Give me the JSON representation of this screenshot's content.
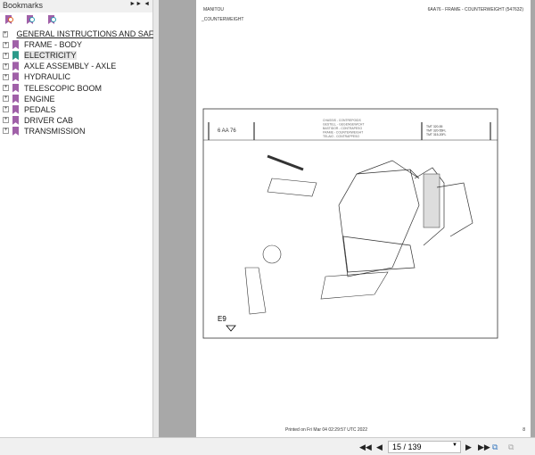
{
  "bookmarks": {
    "title": "Bookmarks",
    "items": [
      {
        "label": "GENERAL INSTRUCTIONS AND SAFETY"
      },
      {
        "label": "FRAME - BODY"
      },
      {
        "label": "ELECTRICITY"
      },
      {
        "label": "AXLE ASSEMBLY - AXLE"
      },
      {
        "label": "HYDRAULIC"
      },
      {
        "label": "TELESCOPIC BOOM"
      },
      {
        "label": "ENGINE"
      },
      {
        "label": "PEDALS"
      },
      {
        "label": "DRIVER CAB"
      },
      {
        "label": "TRANSMISSION"
      }
    ]
  },
  "page": {
    "brand": "MANITOU",
    "ref": "6AA76 - FRAME - COUNTERWEIGHT (547632)",
    "section": "_COUNTERWEIGHT",
    "printed": "Printed on  Fri Mar 04 02:29:57 UTC 2022",
    "page_num": "8",
    "drawing": {
      "code": "6 AA 76",
      "titles": [
        "CHASSIS - CONTREPOIDS",
        "GESTELL - GEGENGEWICHT",
        "BASTIDOR - CONTRAPESO",
        "FRAME - COUNTERWEIGHT",
        "TELAIO - CONTRAPPESO"
      ],
      "models": [
        "TMT 320-55",
        "TMT 320-55FL",
        "TMT 315-20FL"
      ],
      "sheet": "E9"
    }
  },
  "nav": {
    "page_value": "15 / 139"
  }
}
